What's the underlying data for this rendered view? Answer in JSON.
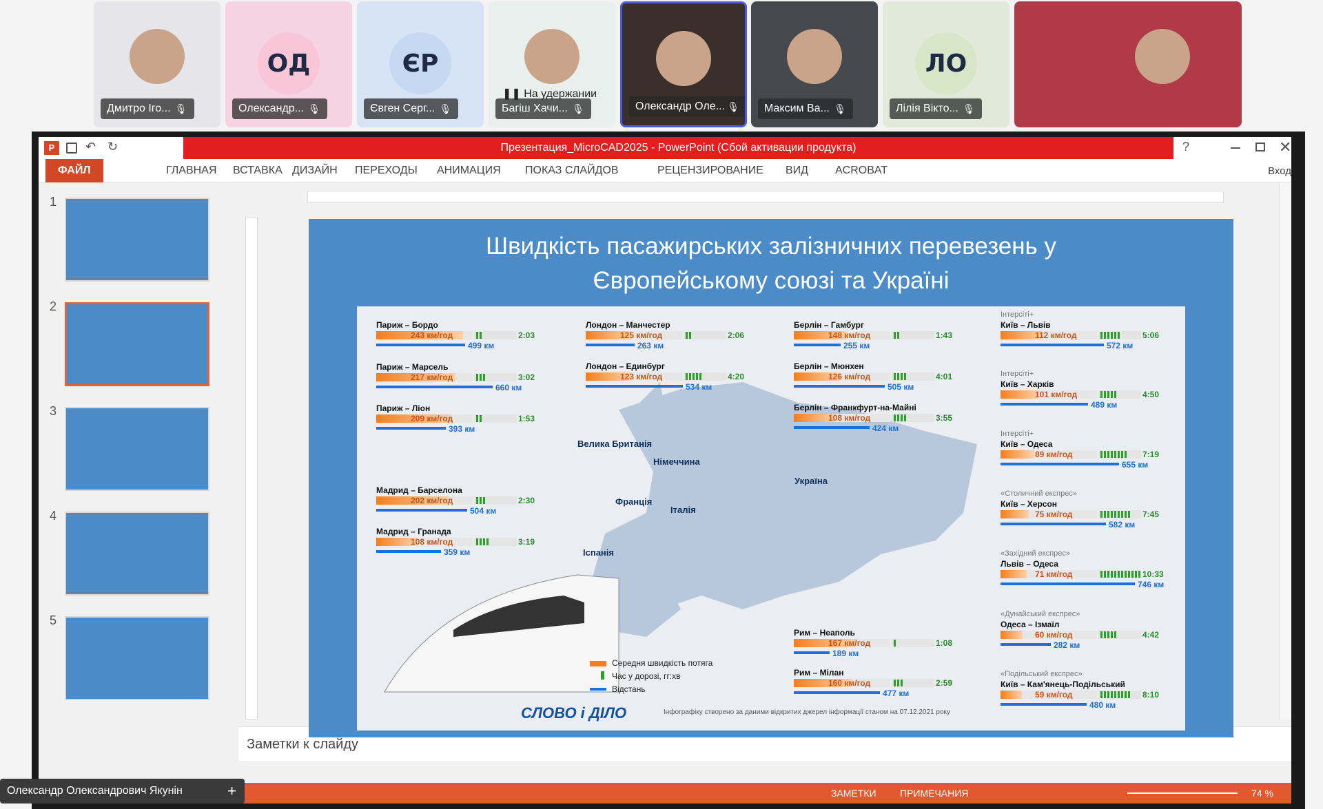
{
  "participants": [
    {
      "name": "Дмитро Іго...",
      "initials": "",
      "photo": true,
      "bg": "#e6e6ea"
    },
    {
      "name": "Олександр...",
      "initials": "ОД",
      "bg": "#f6d3e0"
    },
    {
      "name": "Євген Серг...",
      "initials": "ЄР",
      "bg": "#d7e4f6"
    },
    {
      "name": "Багіш Хачи...",
      "initials": "",
      "photo": true,
      "bg": "#e8efec",
      "status": "На удержании"
    },
    {
      "name": "Олександр Оле...",
      "initials": "",
      "photo": true,
      "bg": "#3a2f2a"
    },
    {
      "name": "Максим Ва...",
      "initials": "",
      "photo": true,
      "bg": "#45484c"
    },
    {
      "name": "Лілія Вікто...",
      "initials": "ЛО",
      "bg": "#e1e9d9"
    },
    {
      "name": "",
      "initials": "",
      "photo": true,
      "bg": "#b03a48"
    }
  ],
  "ppt": {
    "title": "Презентация_MicroCAD2025 - PowerPoint (Сбой активации продукта)",
    "signin": "Вход",
    "tabs": [
      "ФАЙЛ",
      "ГЛАВНАЯ",
      "ВСТАВКА",
      "ДИЗАЙН",
      "ПЕРЕХОДЫ",
      "АНИМАЦИЯ",
      "ПОКАЗ СЛАЙДОВ",
      "РЕЦЕНЗИРОВАНИЕ",
      "ВИД",
      "ACROBAT"
    ],
    "slide_numbers": [
      "1",
      "2",
      "3",
      "4",
      "5"
    ],
    "notes_placeholder": "Заметки к слайду",
    "status": {
      "notes": "ЗАМЕТКИ",
      "comments": "ПРИМЕЧАНИЯ",
      "zoom": "74 %"
    },
    "presenter": "Олександр Олександрович Якунін"
  },
  "slide": {
    "title_line1": "Швидкість пасажирських залізничних перевезень у",
    "title_line2": "Європейському союзі та Україні",
    "countries": [
      "Велика Британія",
      "Німеччина",
      "Франція",
      "Італія",
      "Іспанія",
      "Україна"
    ],
    "legend": {
      "speed": "Середня швидкість потяга",
      "time": "Час у дорозі, гг:хв",
      "distance": "Відстань"
    },
    "logo": "СЛОВО і ДІЛО",
    "footnote": "Інфографіку створено за даними відкритих джерел інформації станом на 07.12.2021 року",
    "routes": [
      {
        "name": "Париж – Бордо",
        "speed": "243 км/год",
        "speed_frac": 0.9,
        "time": "2:03",
        "time_frac": 0.18,
        "dist": "499 км",
        "dist_frac": 0.55
      },
      {
        "name": "Париж – Марсель",
        "speed": "217 км/год",
        "speed_frac": 0.82,
        "time": "3:02",
        "time_frac": 0.28,
        "dist": "660 км",
        "dist_frac": 0.72
      },
      {
        "name": "Париж – Ліон",
        "speed": "209 км/год",
        "speed_frac": 0.78,
        "time": "1:53",
        "time_frac": 0.16,
        "dist": "393 км",
        "dist_frac": 0.43
      },
      {
        "name": "Мадрид – Барселона",
        "speed": "202 км/год",
        "speed_frac": 0.76,
        "time": "2:30",
        "time_frac": 0.22,
        "dist": "504 км",
        "dist_frac": 0.56
      },
      {
        "name": "Мадрид – Гранада",
        "speed": "108 км/год",
        "speed_frac": 0.42,
        "time": "3:19",
        "time_frac": 0.3,
        "dist": "359 км",
        "dist_frac": 0.4
      },
      {
        "name": "Лондон – Манчестер",
        "speed": "125 км/год",
        "speed_frac": 0.48,
        "time": "2:06",
        "time_frac": 0.19,
        "dist": "263 км",
        "dist_frac": 0.3
      },
      {
        "name": "Лондон – Единбург",
        "speed": "123 км/год",
        "speed_frac": 0.47,
        "time": "4:20",
        "time_frac": 0.4,
        "dist": "534 км",
        "dist_frac": 0.6
      },
      {
        "name": "Берлін – Гамбург",
        "speed": "148 км/год",
        "speed_frac": 0.56,
        "time": "1:43",
        "time_frac": 0.15,
        "dist": "255 км",
        "dist_frac": 0.29
      },
      {
        "name": "Берлін – Мюнхен",
        "speed": "126 км/год",
        "speed_frac": 0.48,
        "time": "4:01",
        "time_frac": 0.37,
        "dist": "505 км",
        "dist_frac": 0.56
      },
      {
        "name": "Берлін – Франкфурт-на-Майні",
        "speed": "108 км/год",
        "speed_frac": 0.42,
        "time": "3:55",
        "time_frac": 0.36,
        "dist": "424 км",
        "dist_frac": 0.47
      },
      {
        "name": "Рим – Неаполь",
        "speed": "167 км/год",
        "speed_frac": 0.64,
        "time": "1:08",
        "time_frac": 0.1,
        "dist": "189 км",
        "dist_frac": 0.22
      },
      {
        "name": "Рим – Мілан",
        "speed": "160 км/год",
        "speed_frac": 0.61,
        "time": "2:59",
        "time_frac": 0.27,
        "dist": "477 км",
        "dist_frac": 0.53
      },
      {
        "sub": "Інтерсіті+",
        "name": "Київ – Львів",
        "speed": "112 км/год",
        "speed_frac": 0.44,
        "time": "5:06",
        "time_frac": 0.47,
        "dist": "572 км",
        "dist_frac": 0.64
      },
      {
        "sub": "Інтерсіті+",
        "name": "Київ – Харків",
        "speed": "101 км/год",
        "speed_frac": 0.39,
        "time": "4:50",
        "time_frac": 0.44,
        "dist": "489 км",
        "dist_frac": 0.54
      },
      {
        "sub": "Інтерсіті+",
        "name": "Київ – Одеса",
        "speed": "89 км/год",
        "speed_frac": 0.34,
        "time": "7:19",
        "time_frac": 0.67,
        "dist": "655 км",
        "dist_frac": 0.73
      },
      {
        "sub": "«Столичний експрес»",
        "name": "Київ – Херсон",
        "speed": "75 км/год",
        "speed_frac": 0.29,
        "time": "7:45",
        "time_frac": 0.71,
        "dist": "582 км",
        "dist_frac": 0.65
      },
      {
        "sub": "«Західний експрес»",
        "name": "Львів – Одеса",
        "speed": "71 км/год",
        "speed_frac": 0.27,
        "time": "10:33",
        "time_frac": 0.97,
        "dist": "746 км",
        "dist_frac": 0.83
      },
      {
        "sub": "«Дунайський експрес»",
        "name": "Одеса – Ізмаїл",
        "speed": "60 км/год",
        "speed_frac": 0.23,
        "time": "4:42",
        "time_frac": 0.43,
        "dist": "282 км",
        "dist_frac": 0.31
      },
      {
        "sub": "«Подільський експрес»",
        "name": "Київ – Кам'янець-Подільський",
        "speed": "59 км/год",
        "speed_frac": 0.22,
        "time": "8:10",
        "time_frac": 0.75,
        "dist": "480 км",
        "dist_frac": 0.53
      }
    ]
  }
}
